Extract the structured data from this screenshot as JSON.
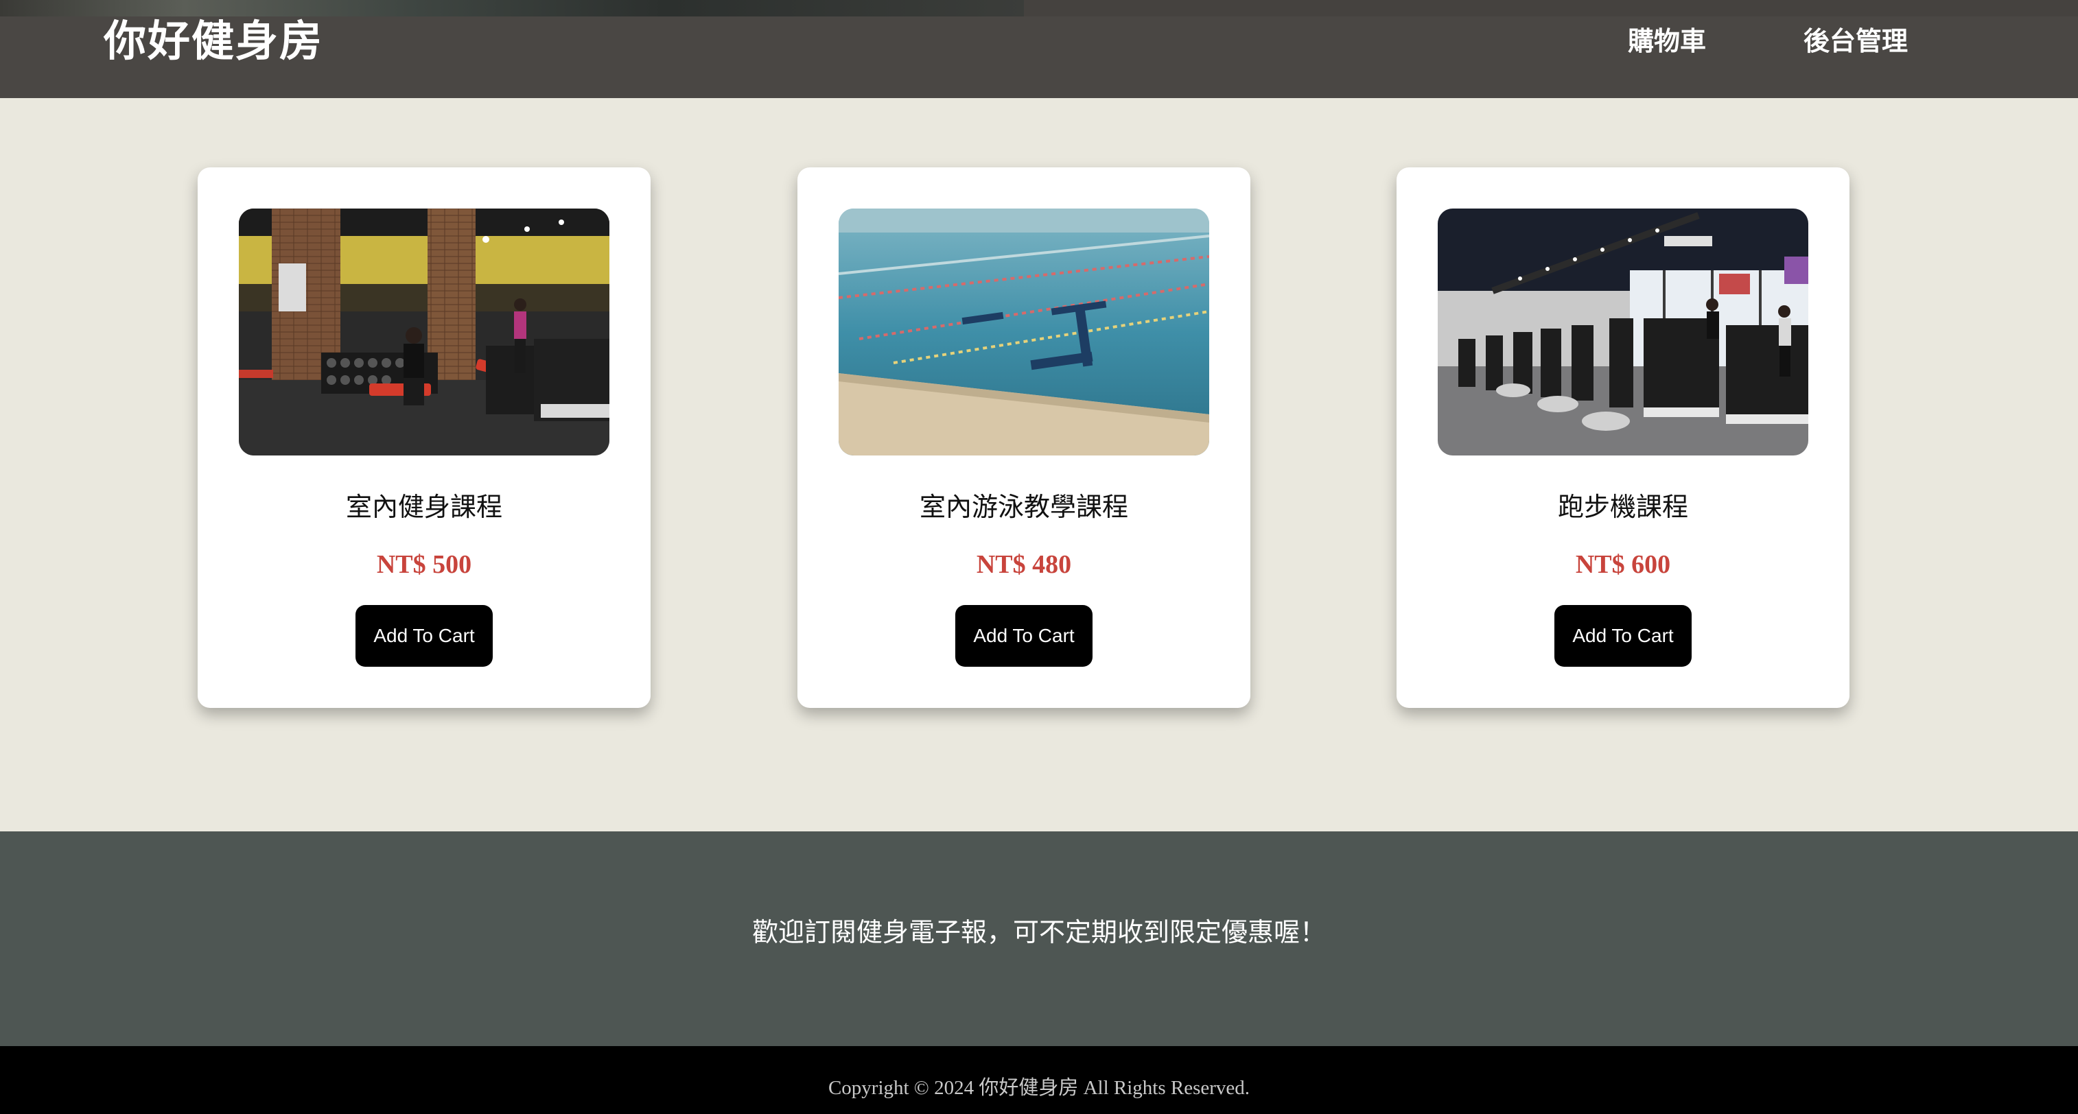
{
  "header": {
    "logo": "你好健身房",
    "nav": {
      "cart": "購物車",
      "admin": "後台管理"
    }
  },
  "products": [
    {
      "title": "室內健身課程",
      "price": "NT$ 500",
      "button": "Add To Cart",
      "image_icon": "gym-photo"
    },
    {
      "title": "室內游泳教學課程",
      "price": "NT$ 480",
      "button": "Add To Cart",
      "image_icon": "swimming-pool-photo"
    },
    {
      "title": "跑步機課程",
      "price": "NT$ 600",
      "button": "Add To Cart",
      "image_icon": "treadmill-photo"
    }
  ],
  "newsletter": {
    "text": "歡迎訂閱健身電子報，可不定期收到限定優惠喔！"
  },
  "footer": {
    "copyright": "Copyright © 2024 你好健身房 All Rights Reserved."
  },
  "colors": {
    "page_background": "#EAE8DE",
    "header_background": "#4A4744",
    "newsletter_background": "#4E5653",
    "footer_background": "#000000",
    "price": "#C8443C",
    "button_background": "#000000"
  }
}
